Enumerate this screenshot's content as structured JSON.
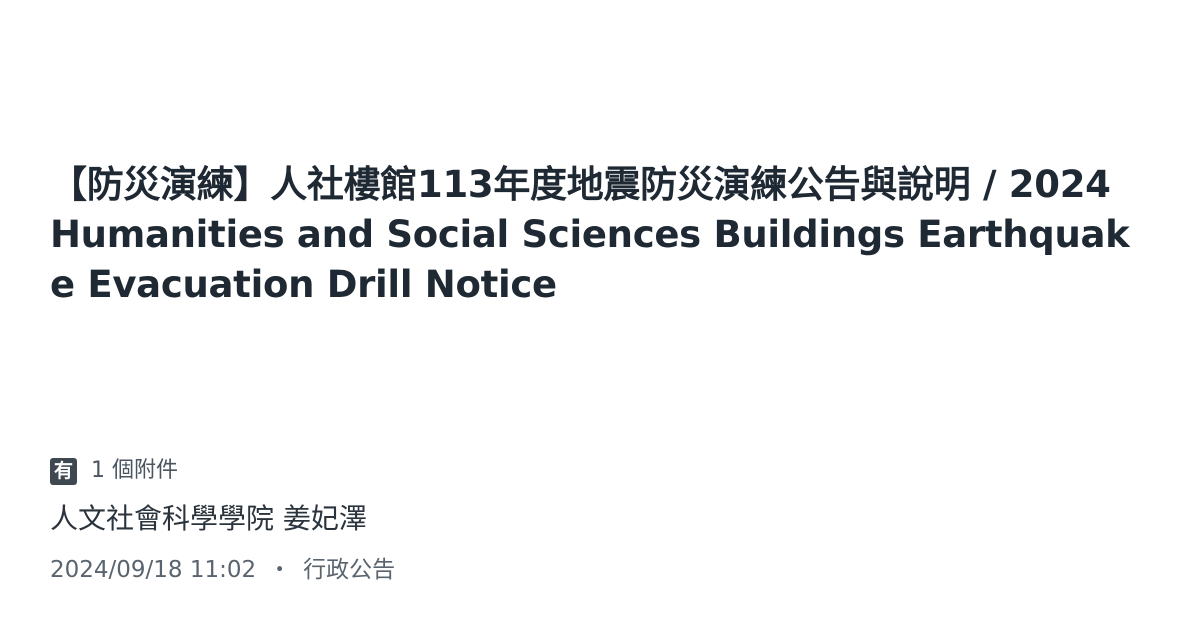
{
  "post": {
    "title": "【防災演練】人社樓館113年度地震防災演練公告與說明 / 2024 Humanities and Social Sciences Buildings Earthquake Evacuation Drill Notice",
    "attachment_icon_glyph": "有",
    "attachment_icon": "attachment-icon",
    "attachments_label": "1 個附件",
    "author": "人文社會科學學院 姜妃澤",
    "date": "2024/09/18 11:02",
    "separator": "・",
    "category": "行政公告"
  },
  "colors": {
    "title": "#1f2933",
    "icon_bg": "#3f4851",
    "meta_text": "#5a646e"
  }
}
